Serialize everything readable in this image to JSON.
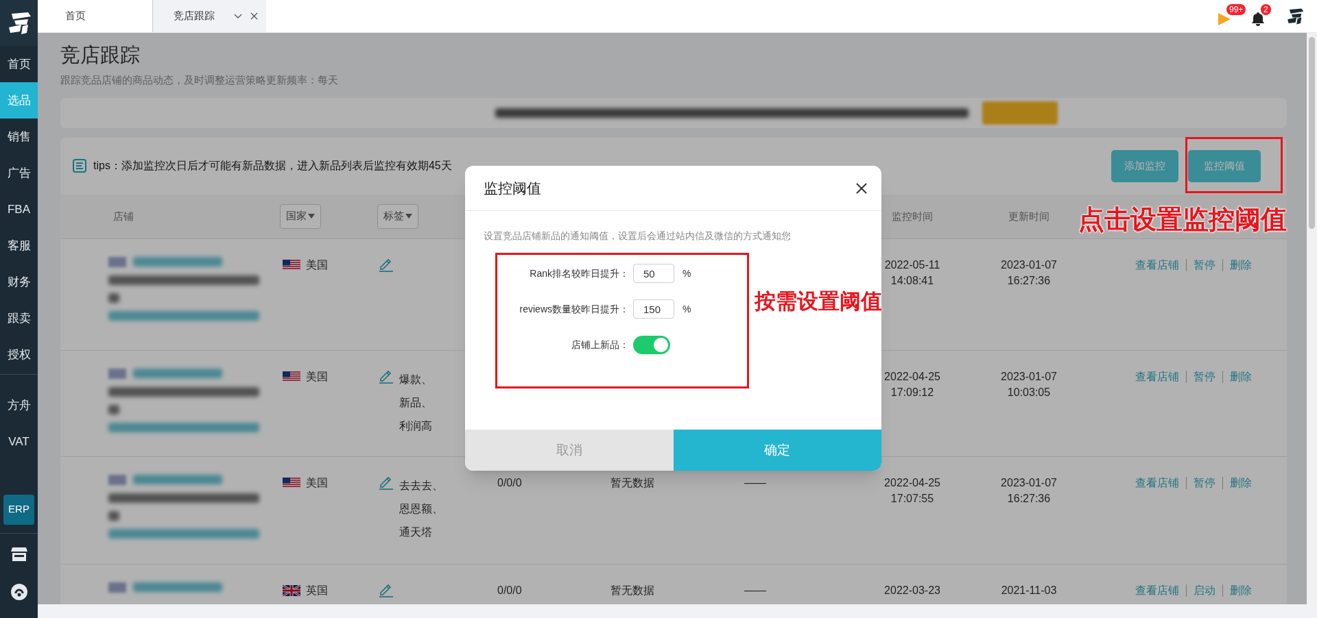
{
  "header": {
    "tabs": [
      {
        "label": "首页",
        "selected": false,
        "closable": false
      },
      {
        "label": "竞店跟踪",
        "selected": true,
        "closable": true
      }
    ],
    "notifications": [
      {
        "kind": "flag",
        "badge": "99+"
      },
      {
        "kind": "bell",
        "badge": "2"
      }
    ]
  },
  "sidebar": {
    "items": [
      {
        "kind": "text",
        "label": "首页",
        "selected": false
      },
      {
        "kind": "text",
        "label": "选品",
        "selected": true
      },
      {
        "kind": "text",
        "label": "销售",
        "selected": false
      },
      {
        "kind": "text",
        "label": "广告",
        "selected": false
      },
      {
        "kind": "text",
        "label": "FBA",
        "selected": false
      },
      {
        "kind": "text",
        "label": "客服",
        "selected": false
      },
      {
        "kind": "text",
        "label": "财务",
        "selected": false
      },
      {
        "kind": "text",
        "label": "跟卖",
        "selected": false
      },
      {
        "kind": "text",
        "label": "授权",
        "selected": false
      },
      {
        "kind": "divider"
      },
      {
        "kind": "text",
        "label": "方舟",
        "selected": false
      },
      {
        "kind": "text",
        "label": "VAT",
        "selected": false
      },
      {
        "kind": "boxed",
        "label": "ERP",
        "selected": false
      },
      {
        "kind": "divider"
      },
      {
        "kind": "icon"
      },
      {
        "kind": "icon"
      }
    ]
  },
  "page": {
    "title": "竞店跟踪",
    "subtitle": "跟踪竞品店铺的商品动态，及时调整运营策略更新频率：每天"
  },
  "tips": "tips：添加监控次日后才可能有新品数据，进入新品列表后监控有效期45天",
  "actions": [
    {
      "label": "添加监控"
    },
    {
      "label": "监控阈值"
    }
  ],
  "table": {
    "columns": [
      {
        "kind": "text",
        "label": "店铺"
      },
      {
        "kind": "filter",
        "label": "国家"
      },
      {
        "kind": "filter",
        "label": "标签"
      },
      {
        "kind": "text",
        "label": "监控时间"
      },
      {
        "kind": "text",
        "label": "更新时间"
      }
    ],
    "rows": [
      {
        "kind": "us",
        "country": "美国",
        "tags": [],
        "monitor_time": [
          "2022-05-11",
          "14:08:41"
        ],
        "update_time": [
          "2023-01-07",
          "16:27:36"
        ],
        "actions": [
          "查看店铺",
          "暂停",
          "删除"
        ]
      },
      {
        "kind": "us",
        "country": "美国",
        "tags": [
          "爆款、",
          "新品、",
          "利润高"
        ],
        "monitor_time": [
          "2022-04-25",
          "17:09:12"
        ],
        "update_time": [
          "2023-01-07",
          "10:03:05"
        ],
        "actions": [
          "查看店铺",
          "暂停",
          "删除"
        ]
      },
      {
        "kind": "us",
        "country": "美国",
        "tags": [
          "去去去、",
          "恩恩额、",
          "通天塔"
        ],
        "column_4": "0/0/0",
        "column_5": "暂无数据",
        "column_6": "——",
        "monitor_time": [
          "2022-04-25",
          "17:07:55"
        ],
        "update_time": [
          "2023-01-07",
          "16:27:36"
        ],
        "actions": [
          "查看店铺",
          "暂停",
          "删除"
        ]
      },
      {
        "kind": "uk",
        "country": "英国",
        "tags": [],
        "column_4": "0/0/0",
        "column_5": "暂无数据",
        "column_6": "——",
        "monitor_time": [
          "2022-03-23"
        ],
        "update_time": [
          "2021-11-03"
        ],
        "actions": [
          "查看店铺",
          "启动",
          "删除"
        ]
      }
    ]
  },
  "modal": {
    "title": "监控阈值",
    "description": "设置竞品店铺新品的通知阈值，设置后会通过站内信及微信的方式通知您",
    "fields": [
      {
        "kind": "input",
        "label": "Rank排名较昨日提升：",
        "value": "50",
        "unit": "%"
      },
      {
        "kind": "input",
        "label": "reviews数量较昨日提升：",
        "value": "150",
        "unit": "%"
      },
      {
        "kind": "switch",
        "label": "店铺上新品：",
        "on": true
      }
    ],
    "buttons": [
      {
        "kind": "cancel",
        "label": "取消"
      },
      {
        "kind": "primary",
        "label": "确定"
      }
    ]
  },
  "annotations": [
    {
      "text": "点击设置监控阈值"
    },
    {
      "text": "按需设置阈值"
    }
  ]
}
